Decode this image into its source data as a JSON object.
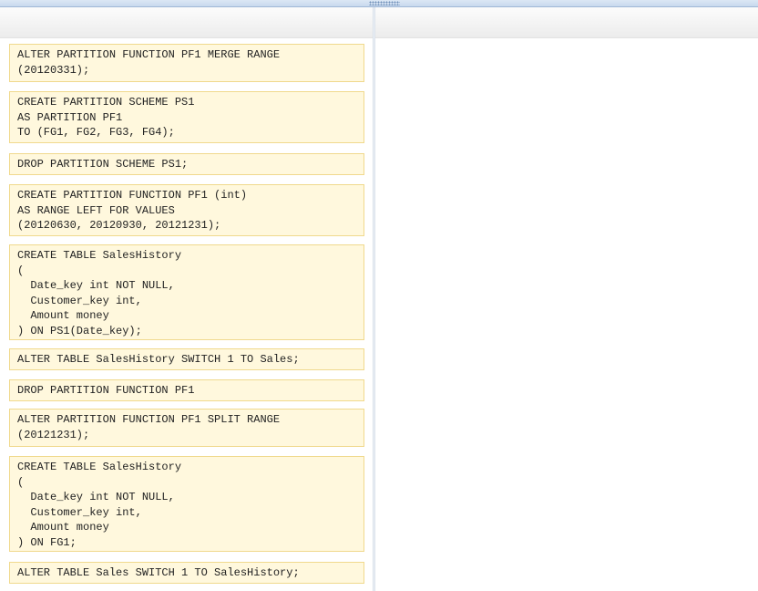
{
  "code_blocks": [
    {
      "id": "merge-range",
      "text": "ALTER PARTITION FUNCTION PF1 MERGE RANGE\n(20120331);"
    },
    {
      "id": "create-scheme",
      "text": "CREATE PARTITION SCHEME PS1\nAS PARTITION PF1\nTO (FG1, FG2, FG3, FG4);"
    },
    {
      "id": "drop-scheme",
      "text": "DROP PARTITION SCHEME PS1;"
    },
    {
      "id": "create-function",
      "text": "CREATE PARTITION FUNCTION PF1 (int)\nAS RANGE LEFT FOR VALUES\n(20120630, 20120930, 20121231);"
    },
    {
      "id": "create-table-ps1",
      "text": "CREATE TABLE SalesHistory\n(\n  Date_key int NOT NULL,\n  Customer_key int,\n  Amount money\n) ON PS1(Date_key);"
    },
    {
      "id": "switch-to-sales",
      "text": "ALTER TABLE SalesHistory SWITCH 1 TO Sales;"
    },
    {
      "id": "drop-function",
      "text": "DROP PARTITION FUNCTION PF1"
    },
    {
      "id": "split-range",
      "text": "ALTER PARTITION FUNCTION PF1 SPLIT RANGE\n(20121231);"
    },
    {
      "id": "create-table-fg1",
      "text": "CREATE TABLE SalesHistory\n(\n  Date_key int NOT NULL,\n  Customer_key int,\n  Amount money\n) ON FG1;"
    },
    {
      "id": "switch-to-saleshistory",
      "text": "ALTER TABLE Sales SWITCH 1 TO SalesHistory;"
    }
  ]
}
